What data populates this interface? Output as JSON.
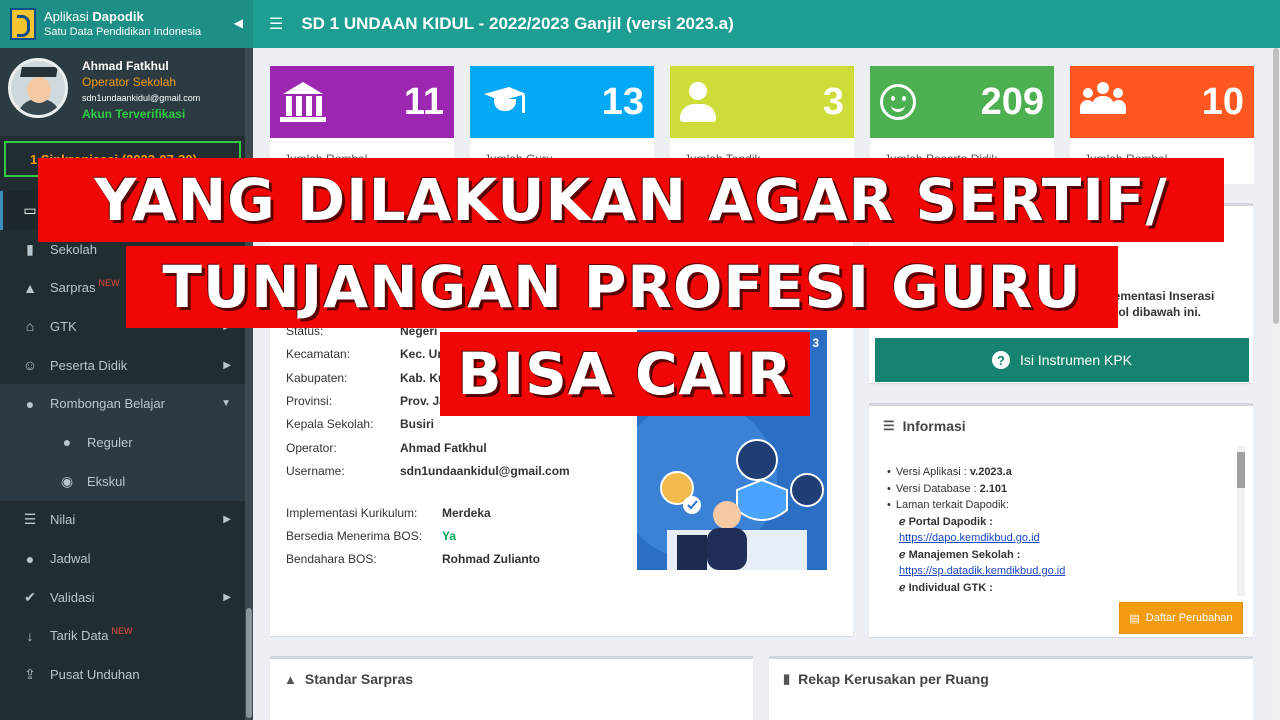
{
  "brand": {
    "app_prefix": "Aplikasi",
    "app_name": "Dapodik",
    "subtitle": "Satu Data Pendidikan Indonesia"
  },
  "user": {
    "name": "Ahmad Fatkhul",
    "role": "Operator Sekolah",
    "email": "sdn1undaankidul@gmail.com",
    "status": "Akun Terverifikasi"
  },
  "sync": {
    "text": "1 Sinkronisasi (2023-07-30)"
  },
  "menu": [
    {
      "label": "",
      "icon": "monitor-icon",
      "active": true
    },
    {
      "label": "Sekolah",
      "icon": "building-icon"
    },
    {
      "label": "Sarpras",
      "icon": "road-icon",
      "badge": "NEW"
    },
    {
      "label": "GTK",
      "icon": "graduation-cap-icon",
      "chevron": true
    },
    {
      "label": "Peserta Didik",
      "icon": "smile-icon",
      "chevron": true
    },
    {
      "label": "Rombongan Belajar",
      "icon": "users-icon",
      "chevron": true
    },
    {
      "label": "Reguler",
      "icon": "users-icon",
      "sub": true
    },
    {
      "label": "Ekskul",
      "icon": "soccer-ball-icon",
      "sub": true
    },
    {
      "label": "Nilai",
      "icon": "list-icon",
      "chevron": true
    },
    {
      "label": "Jadwal",
      "icon": "users-icon"
    },
    {
      "label": "Validasi",
      "icon": "check-icon",
      "chevron": true
    },
    {
      "label": "Tarik Data",
      "icon": "arrow-down-icon",
      "badge": "NEW"
    },
    {
      "label": "Pusat Unduhan",
      "icon": "upload-icon"
    }
  ],
  "header": {
    "title": "SD 1 UNDAAN KIDUL - 2022/2023 Ganjil (versi 2023.a)"
  },
  "stats": [
    {
      "value": "11",
      "label": "Jumlah Rombel",
      "color": "#9c27b0",
      "icon": "institution-icon"
    },
    {
      "value": "13",
      "label": "Jumlah Guru",
      "color": "#03a9f4",
      "icon": "graduation-cap-icon"
    },
    {
      "value": "3",
      "label": "Jumlah Tendik",
      "color": "#cddc39",
      "icon": "person-icon"
    },
    {
      "value": "209",
      "label": "Jumlah Peserta Didik",
      "color": "#4caf50",
      "icon": "smile-icon"
    },
    {
      "value": "10",
      "label": "Jumlah Rombel",
      "color": "#ff5722",
      "icon": "group-icon"
    }
  ],
  "school": {
    "rows": [
      {
        "k": "Status:",
        "v": "Negeri"
      },
      {
        "k": "Kecamatan:",
        "v": "Kec. Undaan"
      },
      {
        "k": "Kabupaten:",
        "v": "Kab. Kudus"
      },
      {
        "k": "Provinsi:",
        "v": "Prov. Jawa Tengah"
      },
      {
        "k": "Kepala Sekolah:",
        "v": "Busiri"
      },
      {
        "k": "Operator:",
        "v": "Ahmad Fatkhul"
      },
      {
        "k": "Username:",
        "v": "sdn1undaankidul@gmail.com"
      }
    ],
    "rows2": [
      {
        "k": "Implementasi Kurikulum:",
        "v": "Merdeka"
      },
      {
        "k": "Bersedia Menerima BOS:",
        "v": "Ya"
      },
      {
        "k": "Bendahara BOS:",
        "v": "Rohmad Zulianto"
      }
    ],
    "illus_badge": "3"
  },
  "kpk": {
    "text1": "Implementasi Inserasi",
    "text2": "tombol dibawah ini.",
    "button": "Isi Instrumen KPK"
  },
  "informasi": {
    "title": "Informasi",
    "app_version_label": "Versi Aplikasi :",
    "app_version": "v.2023.a",
    "db_version_label": "Versi Database :",
    "db_version": "2.101",
    "links_label": "Laman terkait Dapodik:",
    "portal_label": "Portal Dapodik :",
    "portal_url": "https://dapo.kemdikbud.go.id",
    "manajemen_label": "Manajemen Sekolah :",
    "manajemen_url": "https://sp.datadik.kemdikbud.go.id",
    "individual_label": "Individual GTK :",
    "button": "Daftar Perubahan"
  },
  "sarpras": {
    "title": "Standar Sarpras"
  },
  "rekap": {
    "title": "Rekap Kerusakan per Ruang"
  },
  "banner": {
    "line1": "YANG DILAKUKAN AGAR SERTIF/",
    "line2": "TUNJANGAN PROFESI GURU",
    "line3": "BISA CAIR"
  },
  "colors": {
    "header": "#1e9e93",
    "sidebar": "#222d32",
    "banner": "#f10606"
  }
}
